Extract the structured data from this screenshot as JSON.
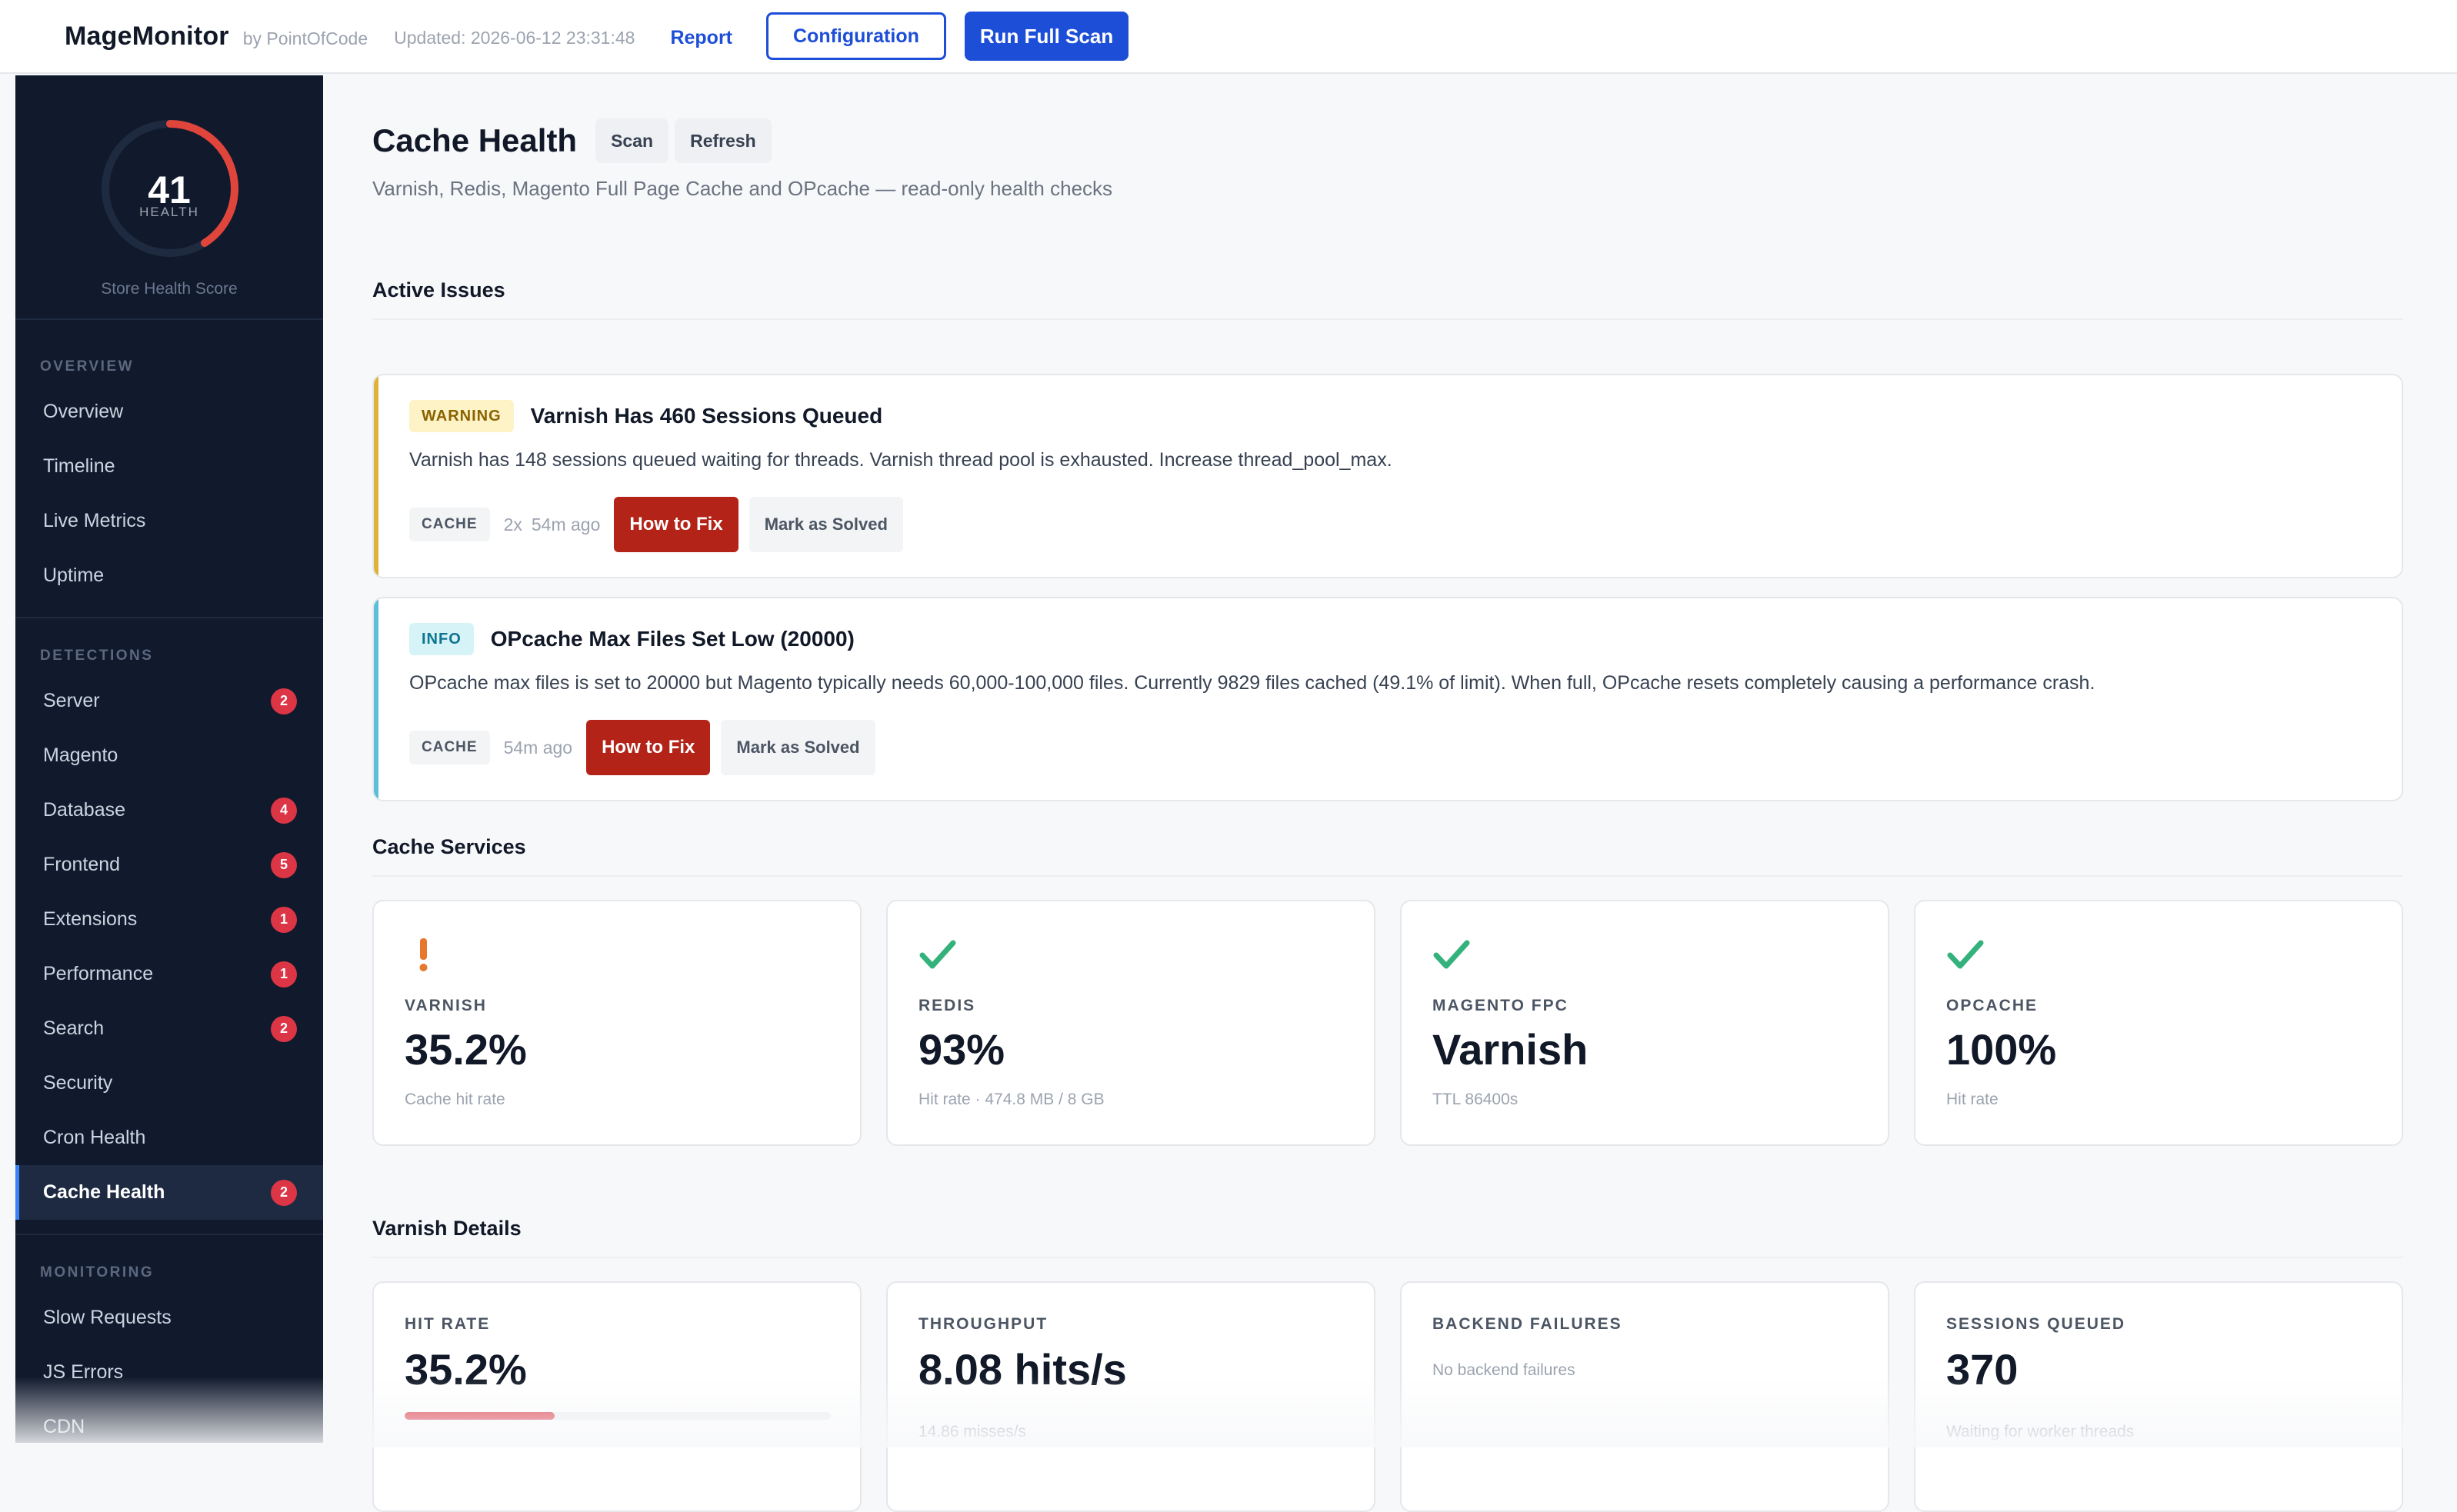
{
  "header": {
    "brand": "MageMonitor",
    "by": "by PointOfCode",
    "updated": "Updated: 2026-06-12 23:31:48",
    "report": "Report",
    "configuration": "Configuration",
    "run_scan": "Run Full Scan"
  },
  "score": {
    "value": "41",
    "label": "HEALTH",
    "caption": "Store Health Score",
    "percent": 41
  },
  "sidebar": {
    "overview_title": "OVERVIEW",
    "overview": [
      {
        "label": "Overview"
      },
      {
        "label": "Timeline"
      },
      {
        "label": "Live Metrics"
      },
      {
        "label": "Uptime"
      }
    ],
    "detections_title": "DETECTIONS",
    "detections": [
      {
        "label": "Server",
        "badge": "2"
      },
      {
        "label": "Magento",
        "badge": ""
      },
      {
        "label": "Database",
        "badge": "4"
      },
      {
        "label": "Frontend",
        "badge": "5"
      },
      {
        "label": "Extensions",
        "badge": "1"
      },
      {
        "label": "Performance",
        "badge": "1"
      },
      {
        "label": "Search",
        "badge": "2"
      },
      {
        "label": "Security",
        "badge": ""
      },
      {
        "label": "Cron Health",
        "badge": ""
      },
      {
        "label": "Cache Health",
        "badge": "2"
      }
    ],
    "monitoring_title": "MONITORING",
    "monitoring": [
      {
        "label": "Slow Requests"
      },
      {
        "label": "JS Errors"
      },
      {
        "label": "CDN"
      }
    ]
  },
  "page": {
    "title": "Cache Health",
    "scan": "Scan",
    "refresh": "Refresh",
    "subtitle": "Varnish, Redis, Magento Full Page Cache and OPcache — read-only health checks"
  },
  "issues": {
    "section_title": "Active Issues",
    "items": [
      {
        "severity": "WARNING",
        "title": "Varnish Has 460 Sessions Queued",
        "description": "Varnish has 148 sessions queued waiting for threads. Varnish thread pool is exhausted. Increase thread_pool_max.",
        "tag": "CACHE",
        "count": "2x",
        "time": "54m ago",
        "fix": "How to Fix",
        "solve": "Mark as Solved",
        "color": "#e0b23a"
      },
      {
        "severity": "INFO",
        "title": "OPcache Max Files Set Low (20000)",
        "description": "OPcache max files is set to 20000 but Magento typically needs 60,000-100,000 files. Currently 9829 files cached (49.1% of limit). When full, OPcache resets completely causing a performance crash.",
        "tag": "CACHE",
        "count": "",
        "time": "54m ago",
        "fix": "How to Fix",
        "solve": "Mark as Solved",
        "color": "#5bbfd6"
      }
    ]
  },
  "services": {
    "section_title": "Cache Services",
    "items": [
      {
        "icon": "warning-icon",
        "label": "VARNISH",
        "value": "35.2%",
        "note": "Cache hit rate"
      },
      {
        "icon": "check-icon",
        "label": "REDIS",
        "value": "93%",
        "note": "Hit rate · 474.8 MB / 8 GB"
      },
      {
        "icon": "check-icon",
        "label": "MAGENTO FPC",
        "value": "Varnish",
        "note": "TTL 86400s"
      },
      {
        "icon": "check-icon",
        "label": "OPCACHE",
        "value": "100%",
        "note": "Hit rate"
      }
    ]
  },
  "varnish": {
    "section_title": "Varnish Details",
    "items": [
      {
        "label": "HIT RATE",
        "value": "35.2%",
        "note": "",
        "progress": 35.2
      },
      {
        "label": "THROUGHPUT",
        "value": "8.08 hits/s",
        "note": "14.86 misses/s"
      },
      {
        "label": "BACKEND FAILURES",
        "value": "",
        "note": "No backend failures"
      },
      {
        "label": "SESSIONS QUEUED",
        "value": "370",
        "note": "Waiting for worker threads"
      }
    ]
  },
  "colors": {
    "accent": "#1d4ed8",
    "danger": "#b42318",
    "badge": "#dc3545",
    "warning": "#e0b23a",
    "info": "#5bbfd6",
    "success": "#34b27b",
    "alert": "#e8772e"
  }
}
